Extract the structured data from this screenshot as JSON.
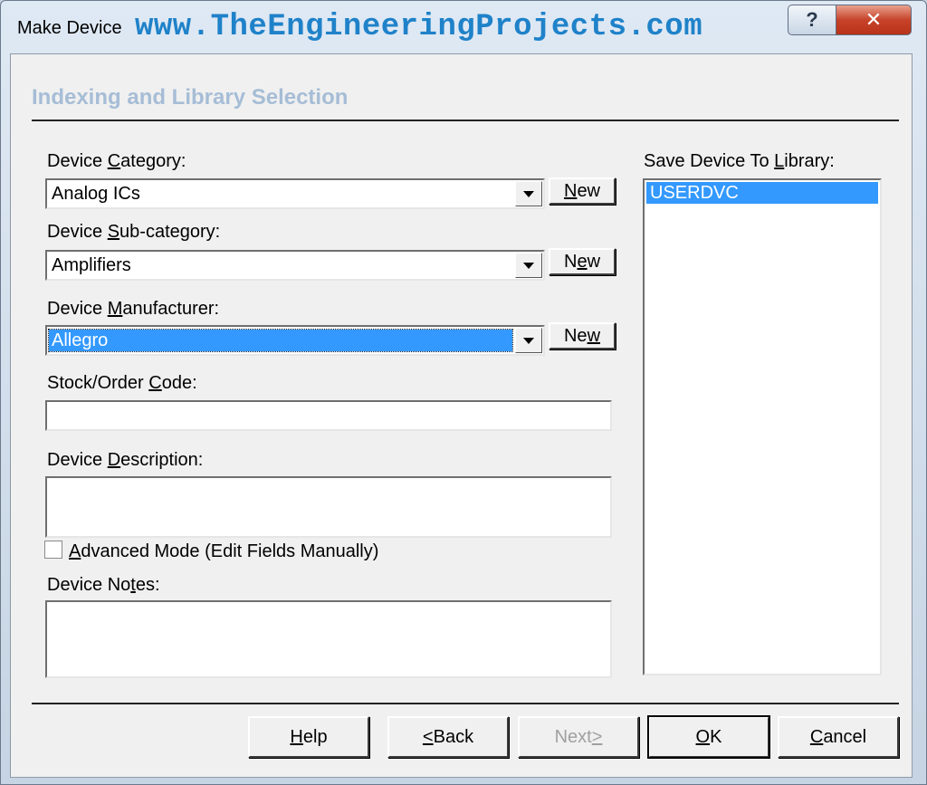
{
  "window": {
    "title": "Make Device",
    "watermark": "www.TheEngineeringProjects.com",
    "help_glyph": "?",
    "close_glyph": "✕"
  },
  "heading": "Indexing and Library Selection",
  "category": {
    "label_pre": "Device ",
    "label_key": "C",
    "label_post": "ategory:",
    "value": "Analog ICs",
    "new_pre": "",
    "new_key": "N",
    "new_post": "ew"
  },
  "subcategory": {
    "label_pre": "Device ",
    "label_key": "S",
    "label_post": "ub-category:",
    "value": "Amplifiers",
    "new_pre": "N",
    "new_key": "e",
    "new_post": "w"
  },
  "manufacturer": {
    "label_pre": "Device ",
    "label_key": "M",
    "label_post": "anufacturer:",
    "value": "Allegro",
    "new_pre": "Ne",
    "new_key": "w",
    "new_post": ""
  },
  "stock": {
    "label_pre": "Stock/Order ",
    "label_key": "C",
    "label_post": "ode:",
    "value": ""
  },
  "description": {
    "label_pre": "Device ",
    "label_key": "D",
    "label_post": "escription:",
    "value": ""
  },
  "advanced": {
    "label_pre": "",
    "label_key": "A",
    "label_post": "dvanced Mode (Edit Fields Manually)",
    "checked": false
  },
  "notes": {
    "label_pre": "Device No",
    "label_key": "t",
    "label_post": "es:",
    "value": ""
  },
  "library": {
    "label_pre": "Save Device To ",
    "label_key": "L",
    "label_post": "ibrary:",
    "items": [
      "USERDVC"
    ]
  },
  "buttons": {
    "help": {
      "pre": "",
      "key": "H",
      "post": "elp"
    },
    "back": {
      "pre": "",
      "key": "<",
      "post": "Back"
    },
    "next": {
      "pre": "Next",
      "key": ">",
      "post": ""
    },
    "ok": {
      "pre": "",
      "key": "O",
      "post": "K"
    },
    "cancel": {
      "pre": "",
      "key": "C",
      "post": "ancel"
    }
  },
  "colors": {
    "selection": "#3399ff",
    "heading": "#a6bdd6",
    "watermark": "#1f82c9",
    "close": "#c7432a"
  }
}
